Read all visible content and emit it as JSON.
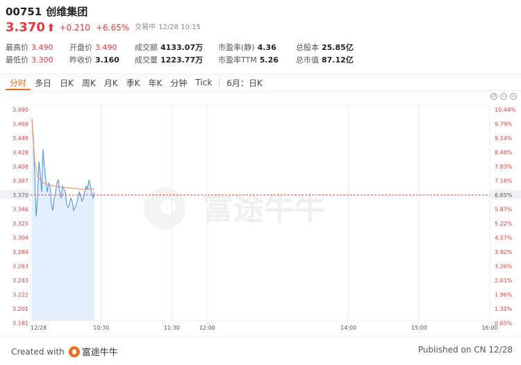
{
  "stock": {
    "code": "00751",
    "name": "创维集团",
    "price": "3.370",
    "arrow": "⬆",
    "change": "+0.210",
    "change_pct": "+6.65%",
    "status": "交易中",
    "time": "12/28 10:15"
  },
  "stats": {
    "row1": [
      {
        "label": "最高价",
        "value": "3.490",
        "tone": "red"
      },
      {
        "label": "开盘价",
        "value": "3.490",
        "tone": "red"
      },
      {
        "label": "成交额",
        "value": "4133.07万",
        "tone": "dark"
      },
      {
        "label": "市盈率(静)",
        "value": "4.36",
        "tone": "dark"
      },
      {
        "label": "总股本",
        "value": "25.85亿",
        "tone": "dark"
      }
    ],
    "row2": [
      {
        "label": "最低价",
        "value": "3.300",
        "tone": "red"
      },
      {
        "label": "昨收价",
        "value": "3.160",
        "tone": "dark"
      },
      {
        "label": "成交量",
        "value": "1223.77万",
        "tone": "dark"
      },
      {
        "label": "市盈率TTM",
        "value": "5.26",
        "tone": "dark"
      },
      {
        "label": "总市值",
        "value": "87.12亿",
        "tone": "dark"
      }
    ]
  },
  "tabs": [
    "分时",
    "多日",
    "日K",
    "周K",
    "月K",
    "季K",
    "年K",
    "分钟",
    "Tick",
    "6月：日K"
  ],
  "zoom_icons": [
    "reset-icon",
    "zoom-out-icon",
    "zoom-in-icon"
  ],
  "watermark": "富途牛牛",
  "footer": {
    "created_with": "Created with",
    "brand": "富途牛牛",
    "published": "Published on CN 12/28"
  },
  "colors": {
    "up": "#e23a3a",
    "accent": "#f26a1b",
    "price_line": "#3d8df0",
    "avg_line": "#f08a3a",
    "area_fill": "#e3eefc",
    "grid": "#ececec"
  },
  "chart_data": {
    "type": "line",
    "prev_close": 3.16,
    "current": 3.37,
    "y_left_ticks": [
      "3.490",
      "3.469",
      "3.449",
      "3.428",
      "3.408",
      "3.387",
      "3.370",
      "3.346",
      "3.325",
      "3.304",
      "3.284",
      "3.263",
      "3.243",
      "3.222",
      "3.201",
      "3.181"
    ],
    "y_right_ticks": [
      "10.44%",
      "9.79%",
      "9.14%",
      "8.48%",
      "7.83%",
      "7.18%",
      "6.65%",
      "5.87%",
      "5.22%",
      "4.57%",
      "3.92%",
      "3.26%",
      "2.61%",
      "1.96%",
      "1.31%",
      "0.65%"
    ],
    "x_ticks": [
      "12/28",
      "10:30",
      "11:30",
      "12:00",
      "14:00",
      "15:00",
      "16:00"
    ],
    "ylim": [
      3.16,
      3.5115
    ],
    "xlim_minutes": [
      0,
      390
    ],
    "series": [
      {
        "role": "price",
        "x": [
          0,
          1,
          2,
          3,
          4,
          5,
          6,
          7,
          8,
          9,
          10,
          11,
          12,
          13,
          14,
          15,
          16,
          17,
          18,
          19,
          20,
          21,
          22,
          23,
          24,
          25,
          26,
          27,
          28,
          29,
          30,
          31,
          32,
          33,
          34,
          35,
          36,
          37,
          38,
          39,
          40,
          41,
          42,
          43,
          44,
          45
        ],
        "values": [
          3.49,
          3.46,
          3.4,
          3.33,
          3.36,
          3.42,
          3.4,
          3.37,
          3.44,
          3.41,
          3.39,
          3.37,
          3.385,
          3.38,
          3.35,
          3.34,
          3.36,
          3.37,
          3.385,
          3.39,
          3.37,
          3.36,
          3.38,
          3.375,
          3.37,
          3.35,
          3.345,
          3.35,
          3.36,
          3.355,
          3.34,
          3.345,
          3.35,
          3.36,
          3.37,
          3.365,
          3.355,
          3.36,
          3.37,
          3.38,
          3.375,
          3.39,
          3.38,
          3.37,
          3.36,
          3.37
        ]
      },
      {
        "role": "average",
        "x": [
          0,
          2,
          4,
          6,
          8,
          10,
          14,
          18,
          22,
          26,
          30,
          35,
          40,
          45
        ],
        "values": [
          3.49,
          3.42,
          3.395,
          3.39,
          3.385,
          3.383,
          3.381,
          3.379,
          3.378,
          3.377,
          3.376,
          3.375,
          3.375,
          3.375
        ]
      }
    ]
  }
}
